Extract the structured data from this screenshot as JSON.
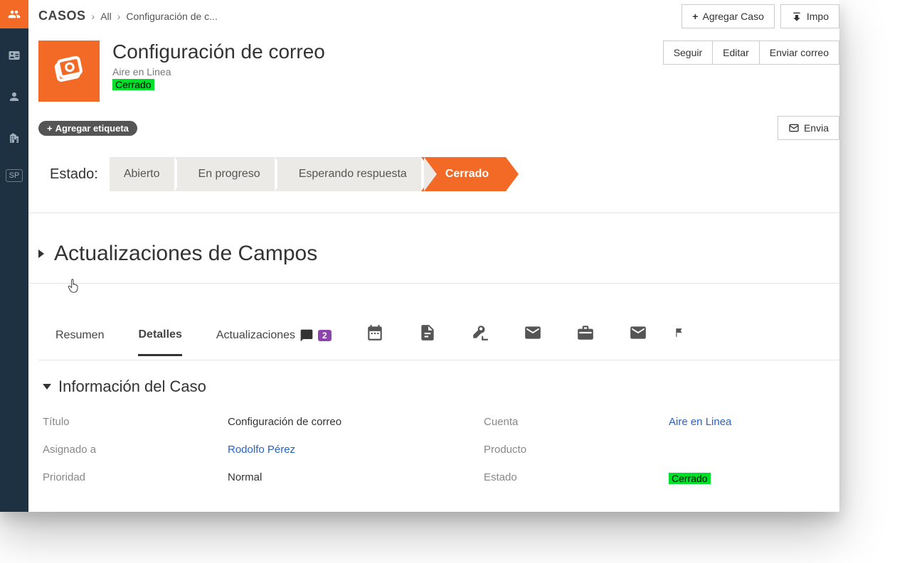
{
  "breadcrumb": {
    "module": "CASOS",
    "filter": "All",
    "current": "Configuración de c..."
  },
  "top_actions": {
    "add_case": "Agregar Caso",
    "import": "Impo"
  },
  "case": {
    "title": "Configuración de correo",
    "account": "Aire en Linea",
    "status": "Cerrado"
  },
  "head_actions": {
    "follow": "Seguir",
    "edit": "Editar",
    "send_email": "Enviar correo"
  },
  "tag": {
    "add_label": "Agregar etiqueta"
  },
  "send_btn": {
    "label": "Envia"
  },
  "state": {
    "label": "Estado:",
    "steps": [
      "Abierto",
      "En progreso",
      "Esperando respuesta",
      "Cerrado"
    ],
    "active": "Cerrado"
  },
  "section_updates": {
    "title": "Actualizaciones de Campos"
  },
  "tabs": {
    "summary": "Resumen",
    "details": "Detalles",
    "updates": "Actualizaciones",
    "updates_count": "2"
  },
  "info": {
    "heading": "Información del Caso",
    "fields": {
      "title_label": "Título",
      "title_val": "Configuración de correo",
      "assigned_label": "Asignado a",
      "assigned_val": "Rodolfo Pérez",
      "priority_label": "Prioridad",
      "priority_val": "Normal",
      "account_label": "Cuenta",
      "account_val": "Aire en Linea",
      "product_label": "Producto",
      "product_val": "",
      "state_label": "Estado",
      "state_val": "Cerrado"
    }
  },
  "sidebar": {
    "sp": "SP"
  }
}
